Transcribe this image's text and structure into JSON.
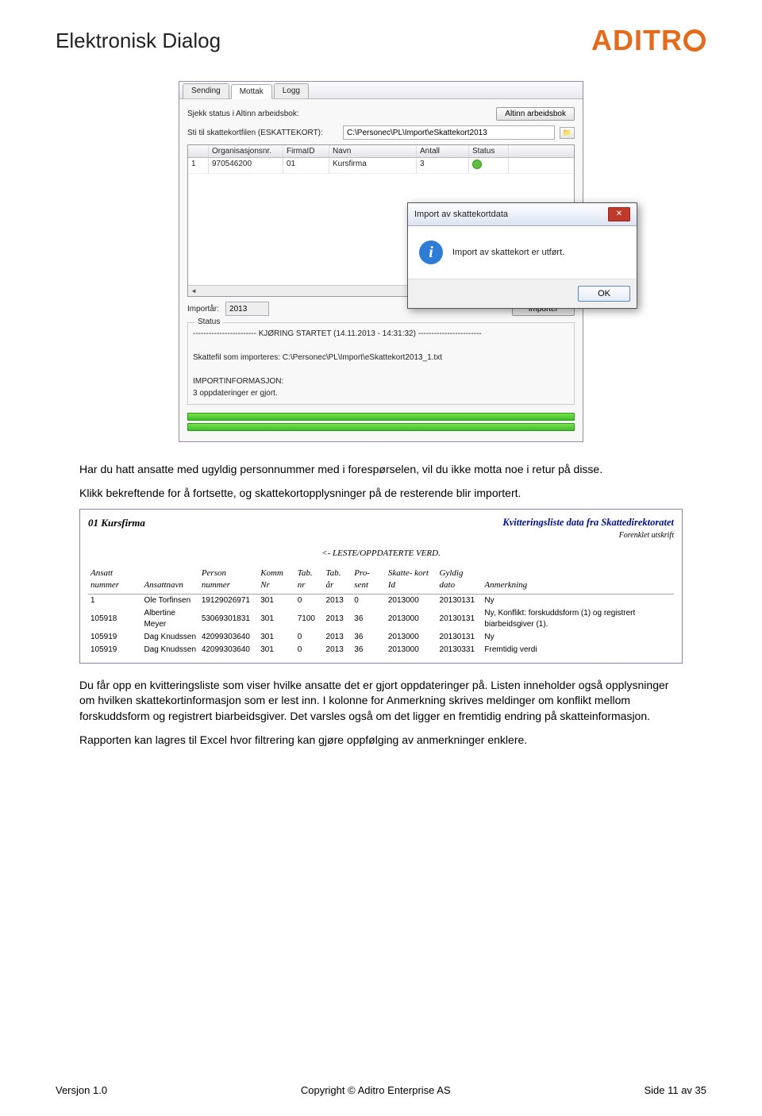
{
  "header": {
    "title": "Elektronisk Dialog",
    "logo_text": "ADITRO"
  },
  "app": {
    "tabs": [
      "Sending",
      "Mottak",
      "Logg"
    ],
    "active_tab": 1,
    "label_status": "Sjekk status i Altinn arbeidsbok:",
    "btn_altinn": "Altinn arbeidsbok",
    "label_path": "Sti til skattekortfilen (ESKATTEKORT):",
    "path_value": "C:\\Personec\\PL\\Import\\eSkattekort2013",
    "grid": {
      "headers": {
        "idx": "",
        "org": "Organisasjonsnr.",
        "fid": "FirmaID",
        "navn": "Navn",
        "ant": "Antall",
        "st": "Status"
      },
      "row": {
        "idx": "1",
        "org": "970546200",
        "fid": "01",
        "navn": "Kursfirma",
        "ant": "3"
      }
    },
    "dialog": {
      "title": "Import av skattekortdata",
      "message": "Import av skattekort er utført.",
      "ok": "OK"
    },
    "import_label": "Importår:",
    "import_year": "2013",
    "btn_import": "Importer",
    "status_legend": "Status",
    "status_text": "------------------------ KJØRING STARTET (14.11.2013 - 14:31:32) ------------------------\n\nSkattefil som importeres: C:\\Personec\\PL\\Import\\eSkattekort2013_1.txt\n\nIMPORTINFORMASJON:\n3 oppdateringer er gjort."
  },
  "para1": "Har du hatt ansatte med ugyldig personnummer med i forespørselen, vil du ikke motta noe i retur på disse.",
  "para2": "Klikk bekreftende for å fortsette, og skattekortopplysninger på de resterende blir importert.",
  "report": {
    "firm": "01 Kursfirma",
    "title_right": "Kvitteringsliste data fra Skattedirektoratet",
    "subtitle_right": "Forenklet utskrift",
    "section": "<- LESTE/OPPDATERTE VERD.",
    "cols": {
      "c1": "Ansatt nummer",
      "c2": "Ansattnavn",
      "c3": "Person nummer",
      "c4": "Komm Nr",
      "c5": "Tab. nr",
      "c6": "Tab. år",
      "c7": "Pro- sent",
      "c8": "Skatte- kort Id",
      "c9": "Gyldig dato",
      "c10": "Anmerkning"
    },
    "rows": [
      {
        "c1": "1",
        "c2": "Ole Torfinsen",
        "c3": "19129026971",
        "c4": "301",
        "c5": "0",
        "c6": "2013",
        "c7": "0",
        "c8": "2013000",
        "c9": "20130131",
        "c10": "Ny"
      },
      {
        "c1": "105918",
        "c2": "Albertine Meyer",
        "c3": "53069301831",
        "c4": "301",
        "c5": "7100",
        "c6": "2013",
        "c7": "36",
        "c8": "2013000",
        "c9": "20130131",
        "c10": "Ny, Konflikt: forskuddsform (1) og registrert biarbeidsgiver (1)."
      },
      {
        "c1": "105919",
        "c2": "Dag Knudssen",
        "c3": "42099303640",
        "c4": "301",
        "c5": "0",
        "c6": "2013",
        "c7": "36",
        "c8": "2013000",
        "c9": "20130131",
        "c10": "Ny"
      },
      {
        "c1": "105919",
        "c2": "Dag Knudssen",
        "c3": "42099303640",
        "c4": "301",
        "c5": "0",
        "c6": "2013",
        "c7": "36",
        "c8": "2013000",
        "c9": "20130331",
        "c10": "Fremtidig verdi"
      }
    ]
  },
  "para3": "Du får opp en kvitteringsliste som viser hvilke ansatte det er gjort oppdateringer på. Listen inneholder også opplysninger om hvilken skattekortinformasjon som er lest inn. I kolonne for Anmerkning skrives meldinger om konflikt mellom forskuddsform og registrert biarbeidsgiver. Det varsles også om det ligger en fremtidig endring på skatteinformasjon.",
  "para4": "Rapporten kan lagres til Excel hvor filtrering kan gjøre oppfølging av anmerkninger enklere.",
  "footer": {
    "left": "Versjon 1.0",
    "center": "Copyright © Aditro Enterprise AS",
    "right": "Side 11 av 35"
  }
}
